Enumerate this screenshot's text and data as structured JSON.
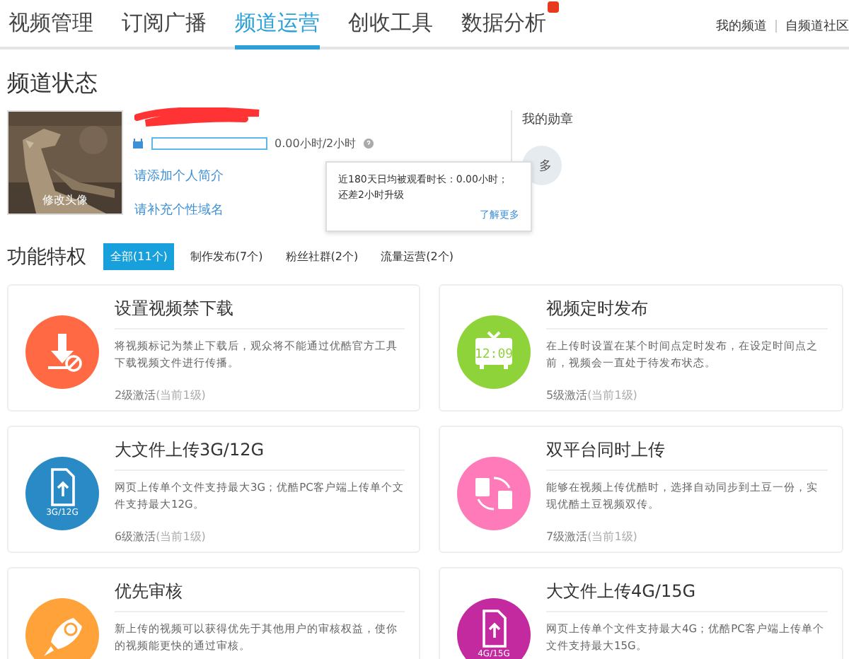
{
  "nav": {
    "tabs": [
      {
        "label": "视频管理",
        "selected": false,
        "badge": false
      },
      {
        "label": "订阅广播",
        "selected": false,
        "badge": false
      },
      {
        "label": "频道运营",
        "selected": true,
        "badge": false
      },
      {
        "label": "创收工具",
        "selected": false,
        "badge": false
      },
      {
        "label": "数据分析",
        "selected": false,
        "badge": true
      }
    ],
    "links": [
      "我的频道",
      "自频道社区"
    ]
  },
  "status": {
    "title": "频道状态",
    "avatar_caption": "修改头像",
    "progress": {
      "level": 0,
      "reading": "0.00小时/2小时"
    },
    "links": [
      "请添加个人简介",
      "请补充个性域名"
    ],
    "tooltip": {
      "lines": [
        "近180天日均被观看时长：0.00小时；",
        "还差2小时升级"
      ],
      "link": "了解更多"
    },
    "medals": {
      "title": "我的勋章",
      "more": "多"
    }
  },
  "features": {
    "title": "功能特权",
    "filters": [
      {
        "label": "全部(11个)",
        "selected": true
      },
      {
        "label": "制作发布(7个)",
        "selected": false
      },
      {
        "label": "粉丝社群(2个)",
        "selected": false
      },
      {
        "label": "流量运营(2个)",
        "selected": false
      }
    ],
    "cards": [
      {
        "title": "设置视频禁下载",
        "desc": "将视频标记为禁止下载后，观众将不能通过优酷官方工具下载视频文件进行传播。",
        "level": "2级激活",
        "current": "(当前1级)",
        "kind": "download",
        "color": "#ff6a45"
      },
      {
        "title": "视频定时发布",
        "desc": "在上传时设置在某个时间点定时发布，在设定时间点之前，视频会一直处于待发布状态。",
        "level": "5级激活",
        "current": "(当前1级)",
        "kind": "clock",
        "color": "#8fd33b",
        "icon_text": "12:09"
      },
      {
        "title": "大文件上传3G/12G",
        "desc": "网页上传单个文件支持最大3G；优酷PC客户端上传单个文件支持最大12G。",
        "level": "6级激活",
        "current": "(当前1级)",
        "kind": "upload",
        "color": "#2a8ac6",
        "icon_text": "3G/12G"
      },
      {
        "title": "双平台同时上传",
        "desc": "能够在视频上传优酷时，选择自动同步到土豆一份，实现优酷土豆视频双传。",
        "level": "7级激活",
        "current": "(当前1级)",
        "kind": "sync",
        "color": "#ff7ab8"
      },
      {
        "title": "优先审核",
        "desc": "新上传的视频可以获得优先于其他用户的审核权益，使你的视频能更快的通过审核。",
        "kind": "rocket",
        "color": "#ffa23a"
      },
      {
        "title": "大文件上传4G/15G",
        "desc": "网页上传单个文件支持最大4G；优酷PC客户端上传单个文件支持最大15G。",
        "kind": "upload",
        "color": "#c42aa0",
        "icon_text": "4G/15G"
      }
    ]
  }
}
